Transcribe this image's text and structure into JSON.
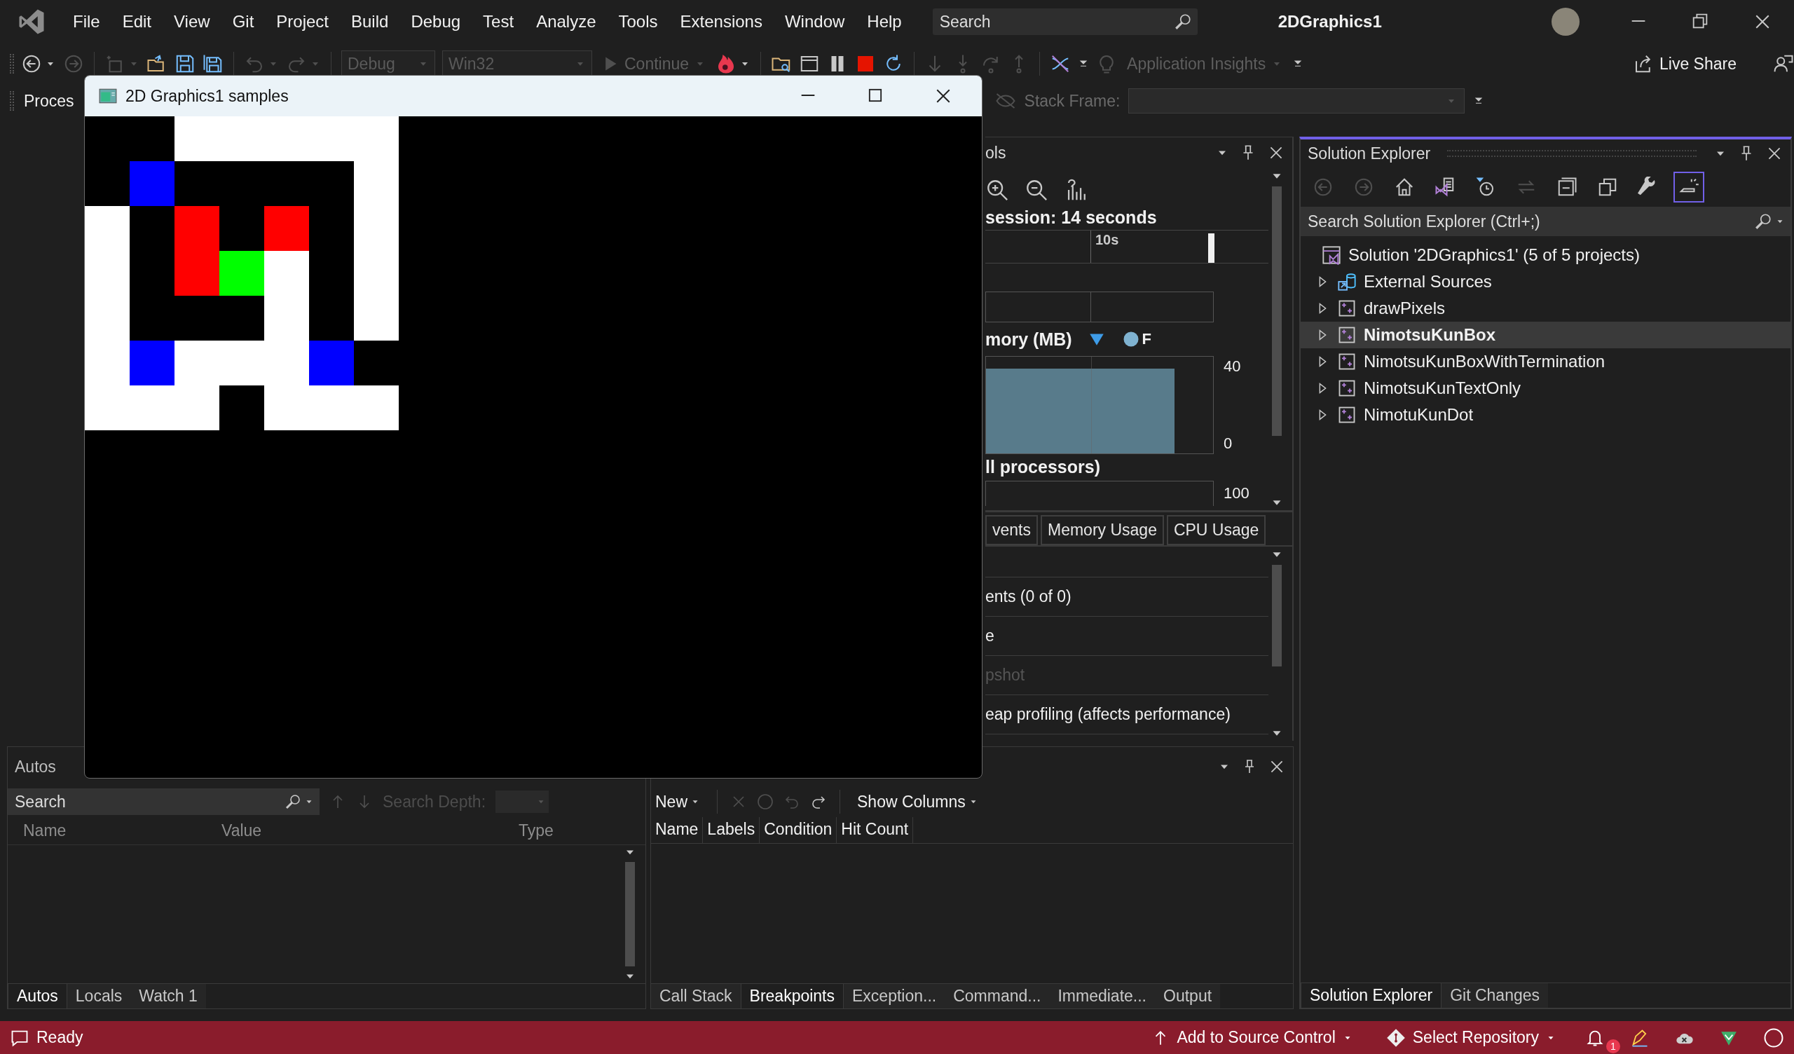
{
  "title_bar": {
    "menu": [
      "File",
      "Edit",
      "View",
      "Git",
      "Project",
      "Build",
      "Debug",
      "Test",
      "Analyze",
      "Tools",
      "Extensions",
      "Window",
      "Help"
    ],
    "search": {
      "placeholder": "Search"
    },
    "solution_name": "2DGraphics1"
  },
  "toolbar": [
    {
      "kind": "icon-menu",
      "disabled": false
    },
    {
      "kind": "icon",
      "disabled": true
    },
    {
      "kind": "separator"
    },
    {
      "kind": "icon-menu",
      "disabled": true
    },
    {
      "kind": "icon",
      "disabled": false
    },
    {
      "kind": "icon",
      "disabled": false
    },
    {
      "kind": "icon",
      "disabled": false
    },
    {
      "kind": "separator"
    },
    {
      "kind": "icon-menu",
      "disabled": true
    },
    {
      "kind": "icon-menu",
      "disabled": true
    },
    {
      "kind": "separator"
    },
    {
      "kind": "config-combo",
      "value": "Debug",
      "disabled": true
    },
    {
      "kind": "platform-combo",
      "value": "Win32",
      "disabled": true
    },
    {
      "kind": "button-menu",
      "label": "Continue",
      "disabled": true
    },
    {
      "kind": "icon-menu",
      "disabled": false
    },
    {
      "kind": "separator"
    },
    {
      "kind": "icon",
      "disabled": false
    },
    {
      "kind": "icon",
      "disabled": false
    },
    {
      "kind": "icon",
      "disabled": false
    },
    {
      "kind": "icon",
      "disabled": false
    },
    {
      "kind": "icon",
      "disabled": false
    },
    {
      "kind": "separator"
    },
    {
      "kind": "icon",
      "disabled": true
    },
    {
      "kind": "icon",
      "disabled": true
    },
    {
      "kind": "icon",
      "disabled": true
    },
    {
      "kind": "icon",
      "disabled": true
    },
    {
      "kind": "separator"
    },
    {
      "kind": "icon",
      "disabled": false
    },
    {
      "kind": "overflow"
    },
    {
      "kind": "icon",
      "disabled": true
    },
    {
      "kind": "button-menu",
      "label": "Application Insights",
      "disabled": true
    },
    {
      "kind": "overflow"
    },
    {
      "kind": "share-button",
      "label": "Live Share"
    },
    {
      "kind": "icon",
      "disabled": false
    }
  ],
  "toolbar_2": {
    "process_label": "Proces",
    "stack_frame": {
      "label": "Stack Frame:",
      "disabled": true
    }
  },
  "diagnostics": {
    "title": "ols",
    "session": "session: 14 seconds",
    "timeline_tick": "10s",
    "memory": {
      "title": "mory (MB)",
      "legend": "F",
      "y_max": "40",
      "y_min": "0"
    },
    "cpu": {
      "title": "ll processors)",
      "y_max": "100"
    },
    "tabs": [
      {
        "label": "vents",
        "selected": false
      },
      {
        "label": "Memory Usage",
        "selected": false
      },
      {
        "label": "CPU Usage",
        "selected": false
      }
    ],
    "rows": [
      {
        "label": "ents (0 of 0)",
        "disabled": false
      },
      {
        "label": "e",
        "disabled": false
      },
      {
        "label": "pshot",
        "disabled": true
      },
      {
        "label": "eap profiling (affects performance)",
        "disabled": false
      }
    ]
  },
  "autos": {
    "title": "Autos",
    "search": {
      "placeholder": "Search"
    },
    "search_depth": {
      "label": "Search Depth:",
      "disabled": true
    },
    "columns": [
      "Name",
      "Value",
      "Type"
    ],
    "tabs": [
      {
        "label": "Autos",
        "selected": true
      },
      {
        "label": "Locals",
        "selected": false
      },
      {
        "label": "Watch 1",
        "selected": false
      }
    ]
  },
  "breakpoints": {
    "new_label": "New",
    "show_columns": "Show Columns",
    "columns": [
      "Name",
      "Labels",
      "Condition",
      "Hit Count"
    ],
    "tabs": [
      {
        "label": "Call Stack",
        "selected": false
      },
      {
        "label": "Breakpoints",
        "selected": true
      },
      {
        "label": "Exception...",
        "selected": false
      },
      {
        "label": "Command...",
        "selected": false
      },
      {
        "label": "Immediate...",
        "selected": false
      },
      {
        "label": "Output",
        "selected": false
      }
    ]
  },
  "solution_explorer": {
    "title": "Solution Explorer",
    "toolbar": [
      {
        "disabled": true,
        "on": false
      },
      {
        "disabled": true,
        "on": false
      },
      {
        "disabled": false,
        "on": false
      },
      {
        "disabled": false,
        "on": false
      },
      {
        "disabled": false,
        "on": false
      },
      {
        "disabled": true,
        "on": false
      },
      {
        "disabled": false,
        "on": false
      },
      {
        "disabled": false,
        "on": false
      },
      {
        "disabled": false,
        "on": false
      },
      {
        "disabled": false,
        "on": true
      }
    ],
    "search": {
      "placeholder": "Search Solution Explorer (Ctrl+;)"
    },
    "tree": {
      "label": "Solution '2DGraphics1' (5 of 5 projects)",
      "kind": "solution",
      "children": [
        {
          "label": "External Sources",
          "kind": "external",
          "expanded": false,
          "selected": false,
          "startup": false
        },
        {
          "label": "drawPixels",
          "kind": "project",
          "expanded": false,
          "selected": false,
          "startup": false
        },
        {
          "label": "NimotsuKunBox",
          "kind": "project",
          "expanded": false,
          "selected": true,
          "startup": true
        },
        {
          "label": "NimotsuKunBoxWithTermination",
          "kind": "project",
          "expanded": false,
          "selected": false,
          "startup": false
        },
        {
          "label": "NimotsuKunTextOnly",
          "kind": "project",
          "expanded": false,
          "selected": false,
          "startup": false
        },
        {
          "label": "NimotuKunDot",
          "kind": "project",
          "expanded": false,
          "selected": false,
          "startup": false
        }
      ]
    },
    "tabs": [
      {
        "label": "Solution Explorer",
        "selected": true
      },
      {
        "label": "Git Changes",
        "selected": false
      }
    ]
  },
  "status_bar": {
    "ready": "Ready",
    "source_control": "Add to Source Control",
    "repository": "Select Repository",
    "notifications": "1"
  },
  "app_window": {
    "title": "2D Graphics1 samples"
  }
}
